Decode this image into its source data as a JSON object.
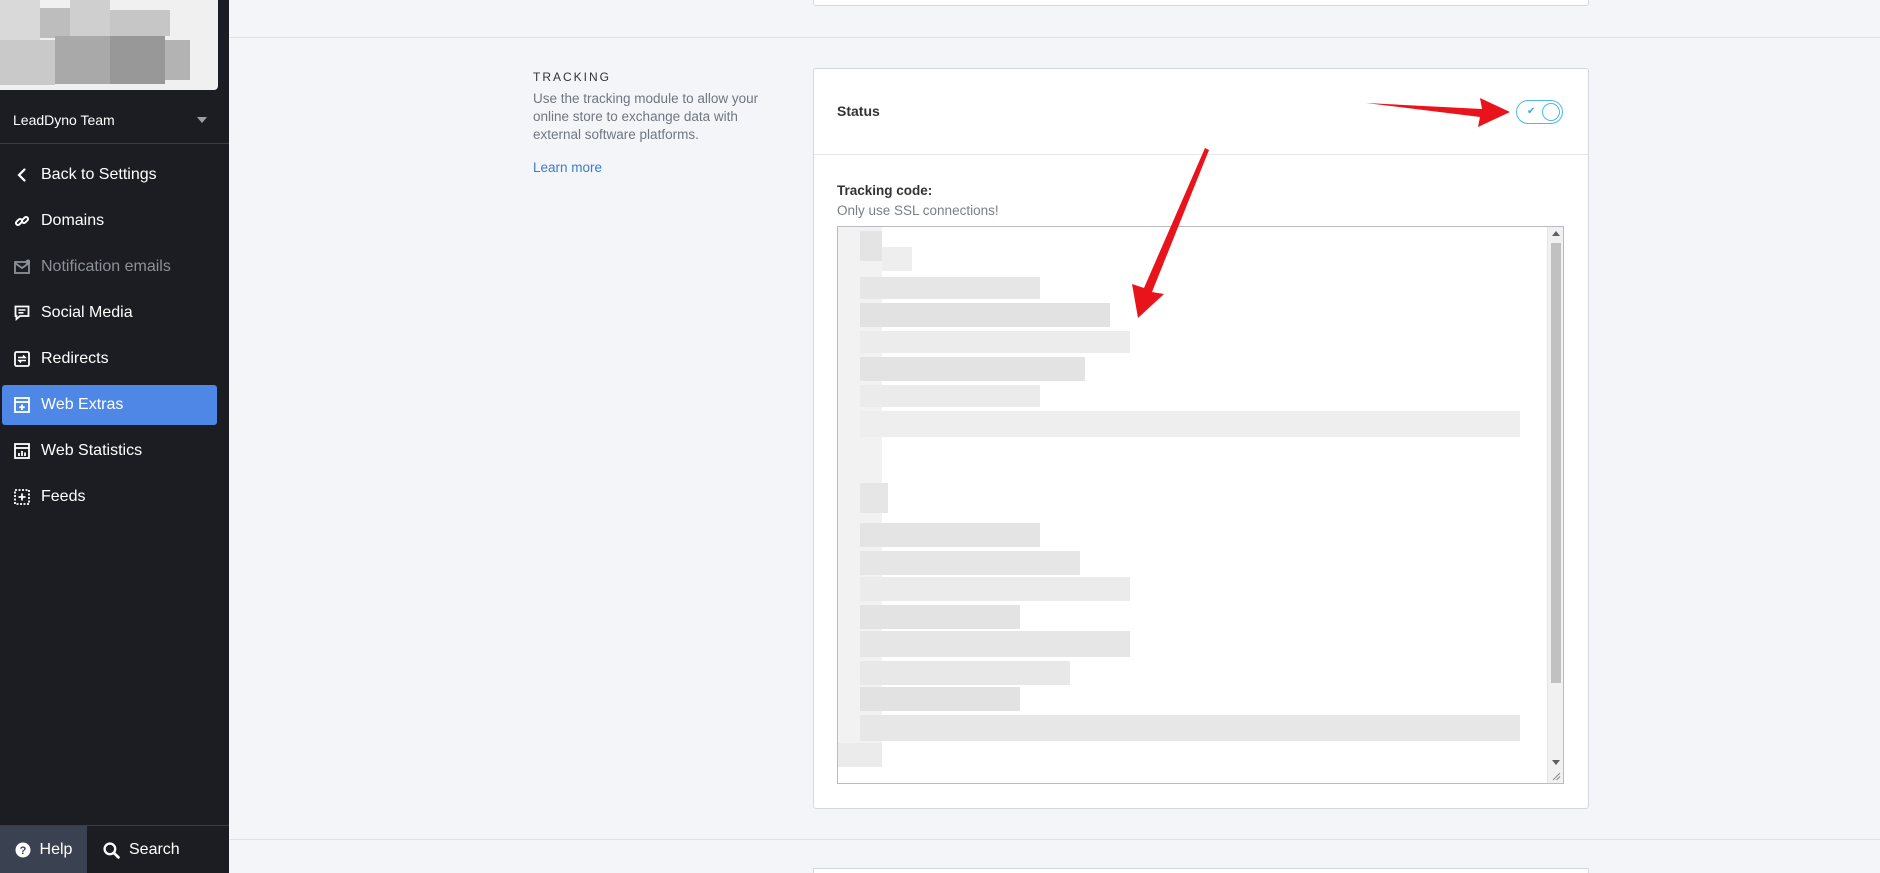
{
  "sidebar": {
    "team_name": "LeadDyno Team",
    "items": [
      {
        "label": "Back to Settings",
        "icon": "chevron-left-icon"
      },
      {
        "label": "Domains",
        "icon": "link-icon"
      },
      {
        "label": "Notification emails",
        "icon": "envelope-icon"
      },
      {
        "label": "Social Media",
        "icon": "chat-icon"
      },
      {
        "label": "Redirects",
        "icon": "redirect-icon"
      },
      {
        "label": "Web Extras",
        "icon": "web-extras-icon"
      },
      {
        "label": "Web Statistics",
        "icon": "stats-icon"
      },
      {
        "label": "Feeds",
        "icon": "feeds-icon"
      }
    ],
    "active_item": "Web Extras",
    "help_label": "Help",
    "search_label": "Search"
  },
  "section": {
    "title": "TRACKING",
    "description": "Use the tracking module to allow your online store to exchange data with external software platforms.",
    "learn_more": "Learn more"
  },
  "card": {
    "status_label": "Status",
    "toggle_on": true,
    "tracking_code_label": "Tracking code:",
    "tracking_code_hint": "Only use SSL connections!"
  },
  "colors": {
    "sidebar_bg": "#1b1d22",
    "accent": "#4e87e6",
    "toggle": "#4fb8e8",
    "link": "#3d7cc9",
    "annotation_arrow": "#e8131b"
  }
}
